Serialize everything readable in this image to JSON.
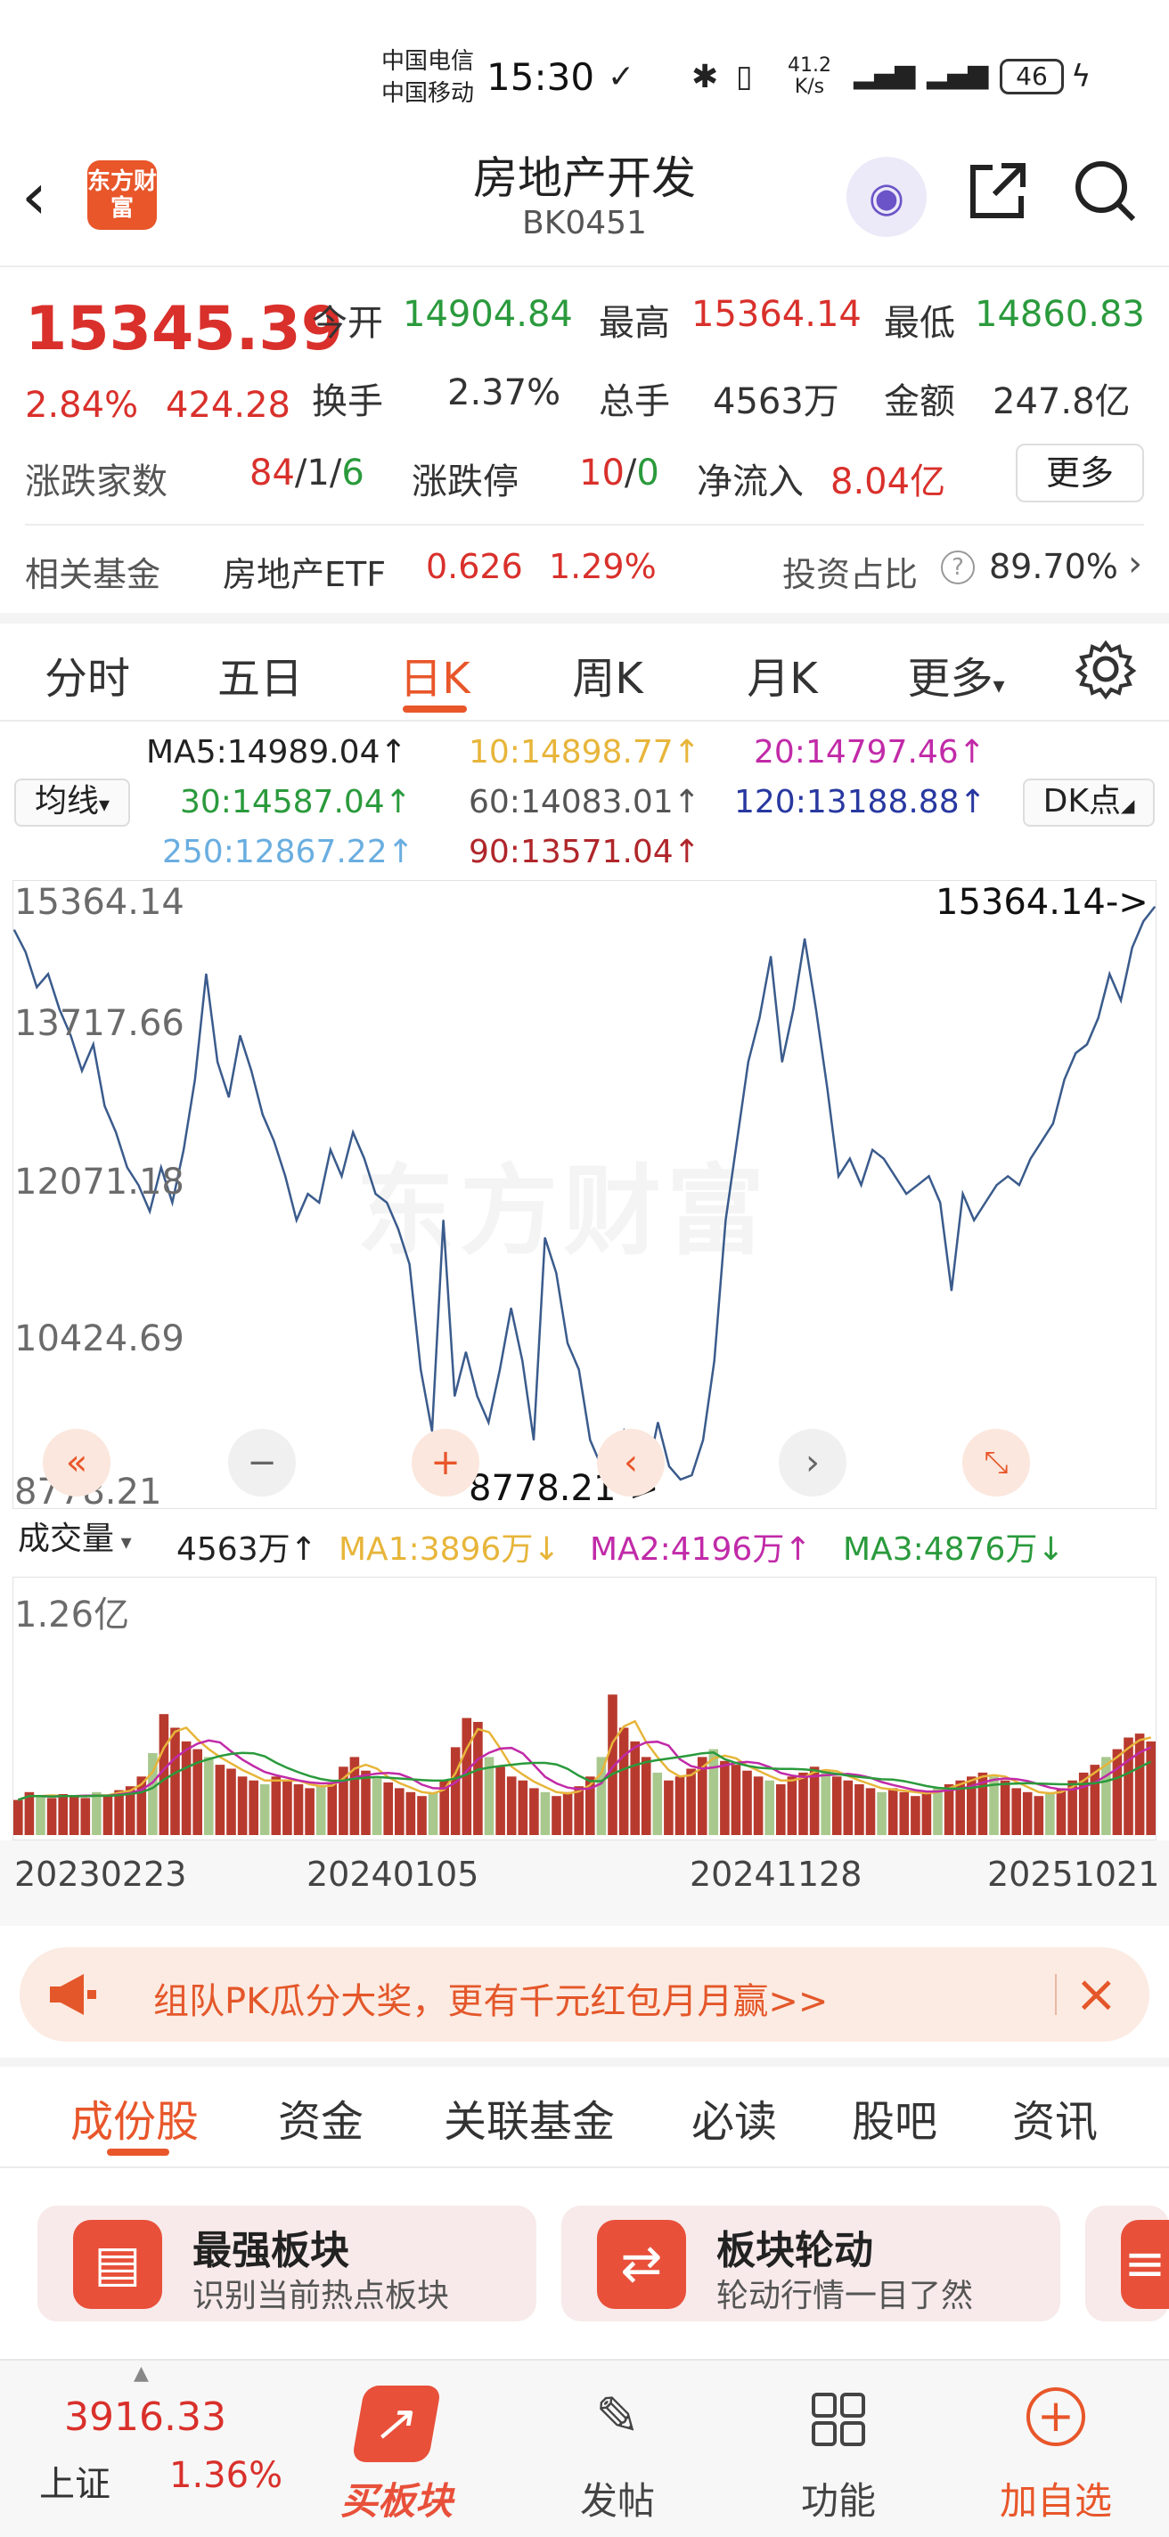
{
  "status_bar": {
    "carrier1": "中国电信",
    "carrier2": "中国移动",
    "time": "15:30",
    "net_speed": "41.2",
    "net_unit": "K/s",
    "battery": "46"
  },
  "header": {
    "logo_text": "东方财富",
    "title": "房地产开发",
    "code": "BK0451"
  },
  "quote": {
    "price": "15345.39",
    "change_pct": "2.84%",
    "change_abs": "424.28",
    "open_label": "今开",
    "open": "14904.84",
    "high_label": "最高",
    "high": "15364.14",
    "low_label": "最低",
    "low": "14860.83",
    "turnover_label": "换手",
    "turnover": "2.37%",
    "volume_label": "总手",
    "volume": "4563万",
    "amount_label": "金额",
    "amount": "247.8亿",
    "breadth_label": "涨跌家数",
    "up": "84",
    "flat": "/1/",
    "down": "6",
    "limit_label": "涨跌停",
    "limit_up": "10",
    "limit_sep": "/",
    "limit_down": "0",
    "inflow_label": "净流入",
    "inflow": "8.04亿",
    "more": "更多"
  },
  "fund": {
    "label": "相关基金",
    "name": "房地产ETF",
    "price": "0.626",
    "pct": "1.29%",
    "ratio_label": "投资占比",
    "ratio": "89.70%"
  },
  "chart_tabs": [
    "分时",
    "五日",
    "日K",
    "周K",
    "月K",
    "更多"
  ],
  "ma_line": {
    "selector": "均线",
    "ma5": "MA5:14989.04↑",
    "ma10": "10:14898.77↑",
    "ma20": "20:14797.46↑",
    "ma30": "30:14587.04↑",
    "ma60": "60:14083.01↑",
    "ma120": "120:13188.88↑",
    "ma250": "250:12867.22↑",
    "ma90": "90:13571.04↑",
    "dk": "DK点"
  },
  "price_axis": [
    "15364.14",
    "13717.66",
    "12071.18",
    "10424.69",
    "8778.21"
  ],
  "price_annotations": {
    "high": "15364.14->",
    "low": "8778.21->"
  },
  "watermark": "东方财富",
  "volume_header": {
    "selector": "成交量",
    "vol": "4563万↑",
    "ma1": "MA1:3896万↓",
    "ma2": "MA2:4196万↑",
    "ma3": "MA3:4876万↓",
    "axis_top": "1.26亿"
  },
  "dates": [
    "20230223",
    "20240105",
    "20241128",
    "20251021"
  ],
  "chart_data": {
    "type": "line",
    "title": "",
    "ylim": [
      8778.21,
      15364.14
    ],
    "x": [
      "20230223",
      "20240105",
      "20241128",
      "20251021"
    ],
    "series": [
      {
        "values": [
          15100,
          14850,
          14450,
          14600,
          14200,
          13900,
          13500,
          13800,
          13100,
          12800,
          12400,
          12200,
          11900,
          12400,
          12000,
          12600,
          13400,
          14600,
          13600,
          13200,
          13900,
          13500,
          13000,
          12700,
          12300,
          11800,
          12100,
          12000,
          12600,
          12300,
          12800,
          12500,
          12100,
          12000,
          11700,
          11300,
          10100,
          9400,
          11800,
          9800,
          10300,
          9800,
          9500,
          10100,
          10800,
          10200,
          9300,
          11600,
          11200,
          10400,
          10100,
          9300,
          9000,
          8900,
          9400,
          9100,
          8880,
          9500,
          9000,
          8850,
          8900,
          9300,
          10200,
          11800,
          12700,
          13600,
          14100,
          14800,
          13600,
          14200,
          15000,
          14200,
          13300,
          12300,
          12500,
          12200,
          12600,
          12500,
          12300,
          12100,
          12200,
          12300,
          12000,
          11000,
          12100,
          11800,
          12000,
          12200,
          12300,
          12200,
          12500,
          12700,
          12900,
          13400,
          13700,
          13800,
          14100,
          14600,
          14300,
          14900,
          15200,
          15364
        ]
      }
    ],
    "volume_values": [
      18,
      22,
      20,
      19,
      21,
      20,
      19,
      22,
      20,
      23,
      25,
      30,
      42,
      62,
      55,
      48,
      44,
      40,
      36,
      34,
      30,
      28,
      26,
      30,
      28,
      26,
      24,
      25,
      27,
      35,
      40,
      33,
      29,
      27,
      24,
      22,
      20,
      22,
      28,
      45,
      60,
      58,
      40,
      35,
      30,
      28,
      24,
      22,
      20,
      22,
      25,
      30,
      40,
      72,
      55,
      48,
      40,
      32,
      28,
      30,
      34,
      40,
      44,
      38,
      36,
      33,
      30,
      28,
      26,
      30,
      32,
      35,
      33,
      30,
      28,
      26,
      24,
      22,
      24,
      22,
      20,
      22,
      24,
      26,
      28,
      30,
      32,
      30,
      28,
      24,
      22,
      20,
      22,
      24,
      28,
      32,
      36,
      40,
      44,
      50,
      52,
      48
    ],
    "volume_ylim": [
      0,
      126
    ]
  },
  "banner": {
    "text": "组队PK瓜分大奖，更有千元红包月月赢>>"
  },
  "sub_tabs": [
    "成份股",
    "资金",
    "关联基金",
    "必读",
    "股吧",
    "资讯"
  ],
  "cards": [
    {
      "title": "最强板块",
      "sub": "识别当前热点板块"
    },
    {
      "title": "板块轮动",
      "sub": "轮动行情一目了然"
    }
  ],
  "bottom_nav": {
    "index_value": "3916.33",
    "index_name": "上证",
    "index_pct": "1.36%",
    "buy": "买板块",
    "post": "发帖",
    "func": "功能",
    "add": "加自选"
  },
  "colors": {
    "up": "#d9302b",
    "down": "#2a9a3c",
    "accent": "#e8562a",
    "line": "#3a5b8c"
  }
}
